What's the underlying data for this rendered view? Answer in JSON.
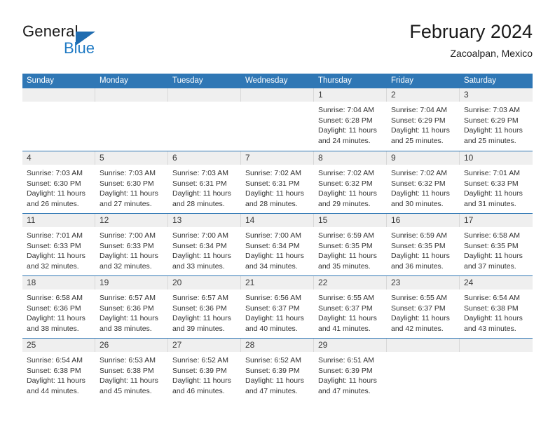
{
  "brand": {
    "name_top": "General",
    "name_bottom": "Blue",
    "flag_icon": "triangle-flag-icon",
    "accent_color": "#1f6cb0"
  },
  "header": {
    "title": "February 2024",
    "subtitle": "Zacoalpan, Mexico"
  },
  "theme": {
    "header_blue": "#2f77b5",
    "day_band_gray": "#efefef",
    "text": "#333333"
  },
  "weekdays": [
    "Sunday",
    "Monday",
    "Tuesday",
    "Wednesday",
    "Thursday",
    "Friday",
    "Saturday"
  ],
  "weeks": [
    [
      {
        "day": "",
        "lines": []
      },
      {
        "day": "",
        "lines": []
      },
      {
        "day": "",
        "lines": []
      },
      {
        "day": "",
        "lines": []
      },
      {
        "day": "1",
        "lines": [
          "Sunrise: 7:04 AM",
          "Sunset: 6:28 PM",
          "Daylight: 11 hours",
          "and 24 minutes."
        ]
      },
      {
        "day": "2",
        "lines": [
          "Sunrise: 7:04 AM",
          "Sunset: 6:29 PM",
          "Daylight: 11 hours",
          "and 25 minutes."
        ]
      },
      {
        "day": "3",
        "lines": [
          "Sunrise: 7:03 AM",
          "Sunset: 6:29 PM",
          "Daylight: 11 hours",
          "and 25 minutes."
        ]
      }
    ],
    [
      {
        "day": "4",
        "lines": [
          "Sunrise: 7:03 AM",
          "Sunset: 6:30 PM",
          "Daylight: 11 hours",
          "and 26 minutes."
        ]
      },
      {
        "day": "5",
        "lines": [
          "Sunrise: 7:03 AM",
          "Sunset: 6:30 PM",
          "Daylight: 11 hours",
          "and 27 minutes."
        ]
      },
      {
        "day": "6",
        "lines": [
          "Sunrise: 7:03 AM",
          "Sunset: 6:31 PM",
          "Daylight: 11 hours",
          "and 28 minutes."
        ]
      },
      {
        "day": "7",
        "lines": [
          "Sunrise: 7:02 AM",
          "Sunset: 6:31 PM",
          "Daylight: 11 hours",
          "and 28 minutes."
        ]
      },
      {
        "day": "8",
        "lines": [
          "Sunrise: 7:02 AM",
          "Sunset: 6:32 PM",
          "Daylight: 11 hours",
          "and 29 minutes."
        ]
      },
      {
        "day": "9",
        "lines": [
          "Sunrise: 7:02 AM",
          "Sunset: 6:32 PM",
          "Daylight: 11 hours",
          "and 30 minutes."
        ]
      },
      {
        "day": "10",
        "lines": [
          "Sunrise: 7:01 AM",
          "Sunset: 6:33 PM",
          "Daylight: 11 hours",
          "and 31 minutes."
        ]
      }
    ],
    [
      {
        "day": "11",
        "lines": [
          "Sunrise: 7:01 AM",
          "Sunset: 6:33 PM",
          "Daylight: 11 hours",
          "and 32 minutes."
        ]
      },
      {
        "day": "12",
        "lines": [
          "Sunrise: 7:00 AM",
          "Sunset: 6:33 PM",
          "Daylight: 11 hours",
          "and 32 minutes."
        ]
      },
      {
        "day": "13",
        "lines": [
          "Sunrise: 7:00 AM",
          "Sunset: 6:34 PM",
          "Daylight: 11 hours",
          "and 33 minutes."
        ]
      },
      {
        "day": "14",
        "lines": [
          "Sunrise: 7:00 AM",
          "Sunset: 6:34 PM",
          "Daylight: 11 hours",
          "and 34 minutes."
        ]
      },
      {
        "day": "15",
        "lines": [
          "Sunrise: 6:59 AM",
          "Sunset: 6:35 PM",
          "Daylight: 11 hours",
          "and 35 minutes."
        ]
      },
      {
        "day": "16",
        "lines": [
          "Sunrise: 6:59 AM",
          "Sunset: 6:35 PM",
          "Daylight: 11 hours",
          "and 36 minutes."
        ]
      },
      {
        "day": "17",
        "lines": [
          "Sunrise: 6:58 AM",
          "Sunset: 6:35 PM",
          "Daylight: 11 hours",
          "and 37 minutes."
        ]
      }
    ],
    [
      {
        "day": "18",
        "lines": [
          "Sunrise: 6:58 AM",
          "Sunset: 6:36 PM",
          "Daylight: 11 hours",
          "and 38 minutes."
        ]
      },
      {
        "day": "19",
        "lines": [
          "Sunrise: 6:57 AM",
          "Sunset: 6:36 PM",
          "Daylight: 11 hours",
          "and 38 minutes."
        ]
      },
      {
        "day": "20",
        "lines": [
          "Sunrise: 6:57 AM",
          "Sunset: 6:36 PM",
          "Daylight: 11 hours",
          "and 39 minutes."
        ]
      },
      {
        "day": "21",
        "lines": [
          "Sunrise: 6:56 AM",
          "Sunset: 6:37 PM",
          "Daylight: 11 hours",
          "and 40 minutes."
        ]
      },
      {
        "day": "22",
        "lines": [
          "Sunrise: 6:55 AM",
          "Sunset: 6:37 PM",
          "Daylight: 11 hours",
          "and 41 minutes."
        ]
      },
      {
        "day": "23",
        "lines": [
          "Sunrise: 6:55 AM",
          "Sunset: 6:37 PM",
          "Daylight: 11 hours",
          "and 42 minutes."
        ]
      },
      {
        "day": "24",
        "lines": [
          "Sunrise: 6:54 AM",
          "Sunset: 6:38 PM",
          "Daylight: 11 hours",
          "and 43 minutes."
        ]
      }
    ],
    [
      {
        "day": "25",
        "lines": [
          "Sunrise: 6:54 AM",
          "Sunset: 6:38 PM",
          "Daylight: 11 hours",
          "and 44 minutes."
        ]
      },
      {
        "day": "26",
        "lines": [
          "Sunrise: 6:53 AM",
          "Sunset: 6:38 PM",
          "Daylight: 11 hours",
          "and 45 minutes."
        ]
      },
      {
        "day": "27",
        "lines": [
          "Sunrise: 6:52 AM",
          "Sunset: 6:39 PM",
          "Daylight: 11 hours",
          "and 46 minutes."
        ]
      },
      {
        "day": "28",
        "lines": [
          "Sunrise: 6:52 AM",
          "Sunset: 6:39 PM",
          "Daylight: 11 hours",
          "and 47 minutes."
        ]
      },
      {
        "day": "29",
        "lines": [
          "Sunrise: 6:51 AM",
          "Sunset: 6:39 PM",
          "Daylight: 11 hours",
          "and 47 minutes."
        ]
      },
      {
        "day": "",
        "lines": []
      },
      {
        "day": "",
        "lines": []
      }
    ]
  ]
}
